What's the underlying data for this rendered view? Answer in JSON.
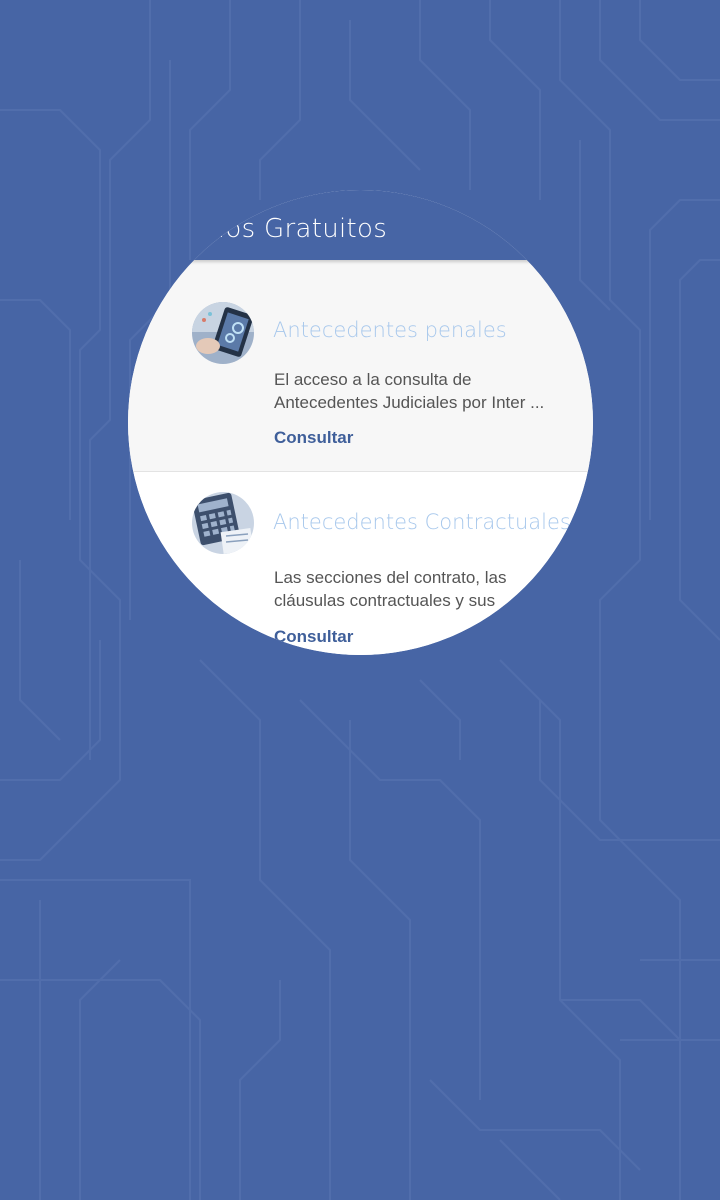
{
  "header": {
    "title": "Servicios Gratuitos"
  },
  "services": [
    {
      "title": "Antecedentes penales",
      "description_line1": "El acceso a la consulta de",
      "description_line2": "Antecedentes Judiciales por Inter ...",
      "action_label": "Consultar",
      "thumbnail_icon": "tablet-chart-icon"
    },
    {
      "title": "Antecedentes Contractuales",
      "description_line1": "Las secciones del contrato, las",
      "description_line2": "cláusulas contractuales y sus",
      "action_label": "Consultar",
      "thumbnail_icon": "calculator-icon"
    }
  ],
  "colors": {
    "brand": "#4765a5",
    "title_accent": "#a8c8ec",
    "action": "#3f5f9a"
  }
}
